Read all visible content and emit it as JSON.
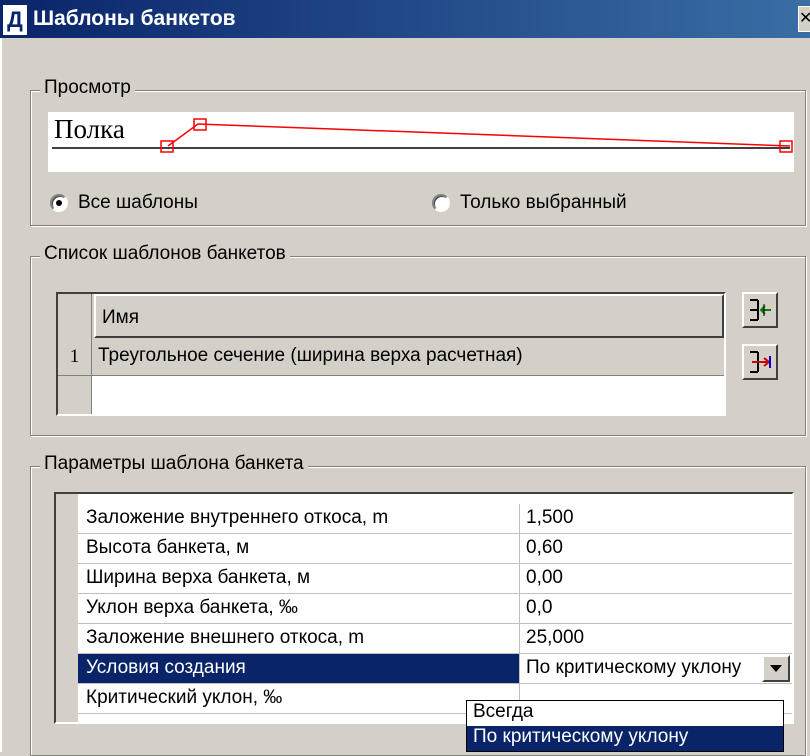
{
  "window": {
    "icon_letter": "Д",
    "title": "Шаблоны банкетов",
    "close_glyph": "✕"
  },
  "preview": {
    "group_label": "Просмотр",
    "canvas_text": "Полка",
    "radio_all_label": "Все шаблоны",
    "radio_selected_label": "Только выбранный",
    "selected_option": "Все шаблоны",
    "profile_color": "#ff0000"
  },
  "templates": {
    "group_label": "Список шаблонов банкетов",
    "column_header": "Имя",
    "rows": [
      {
        "num": "1",
        "name": "Треугольное сечение (ширина верха расчетная)"
      }
    ],
    "buttons": [
      "insert-template-icon",
      "export-template-icon"
    ]
  },
  "params": {
    "group_label": "Параметры шаблона банкета",
    "rows": [
      {
        "name": "Заложение внутреннего откоса, m",
        "value": "1,500"
      },
      {
        "name": "Высота банкета, м",
        "value": "0,60"
      },
      {
        "name": "Ширина верха банкета, м",
        "value": "0,00"
      },
      {
        "name": "Уклон верха банкета, ‰",
        "value": "0,0"
      },
      {
        "name": "Заложение внешнего откоса, m",
        "value": "25,000"
      },
      {
        "name": "Условия создания",
        "value": "По критическому уклону"
      },
      {
        "name": "Критический уклон, ‰",
        "value": ""
      }
    ],
    "dropdown_options": [
      "Всегда",
      "По критическому уклону"
    ],
    "dropdown_highlighted": "По критическому уклону",
    "selection_color": "#0a246a"
  }
}
